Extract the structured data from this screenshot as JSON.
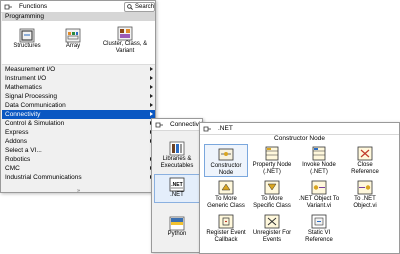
{
  "functions": {
    "title": "Functions",
    "search_label": "Search",
    "programming_label": "Programming",
    "sub_items": [
      {
        "label": "Structures",
        "icon": "structures-icon"
      },
      {
        "label": "Array",
        "icon": "array-icon"
      },
      {
        "label": "Cluster, Class, & Variant",
        "icon": "cluster-icon"
      }
    ],
    "categories": [
      "Measurement I/O",
      "Instrument I/O",
      "Mathematics",
      "Signal Processing",
      "Data Communication",
      "Connectivity",
      "Control & Simulation",
      "Express",
      "Addons",
      "Select a VI...",
      "Robotics",
      "CMC",
      "Industrial Communications"
    ],
    "selected_category": "Connectivity",
    "more_glyph": "»"
  },
  "connectivity": {
    "title": "Connectivit",
    "items": [
      {
        "label": "Libraries & Executables",
        "icon": "libraries-icon"
      },
      {
        "label": ".NET",
        "icon": "dotnet-icon"
      },
      {
        "label": "Python",
        "icon": "python-icon"
      }
    ]
  },
  "dotnet": {
    "title": ".NET",
    "section": "Constructor Node",
    "items": [
      {
        "label": "Constructor Node",
        "icon": "constructor-node-icon"
      },
      {
        "label": "Property Node (.NET)",
        "icon": "property-node-icon"
      },
      {
        "label": "Invoke Node (.NET)",
        "icon": "invoke-node-icon"
      },
      {
        "label": "Close Reference",
        "icon": "close-reference-icon"
      },
      {
        "label": "To More Generic Class",
        "icon": "to-more-generic-class-icon"
      },
      {
        "label": "To More Specific Class",
        "icon": "to-more-specific-class-icon"
      },
      {
        "label": ".NET Object To Variant.vi",
        "icon": "net-object-to-variant-icon"
      },
      {
        "label": "To .NET Object.vi",
        "icon": "to-net-object-icon"
      },
      {
        "label": "Register Event Callback",
        "icon": "register-event-callback-icon"
      },
      {
        "label": "Unregister For Events",
        "icon": "unregister-for-events-icon"
      },
      {
        "label": "Static VI Reference",
        "icon": "static-vi-reference-icon"
      }
    ]
  },
  "colors": {
    "selection": "#0a57c2",
    "panel_bg": "#f0f0f0",
    "category_header": "#d6d6d6"
  }
}
